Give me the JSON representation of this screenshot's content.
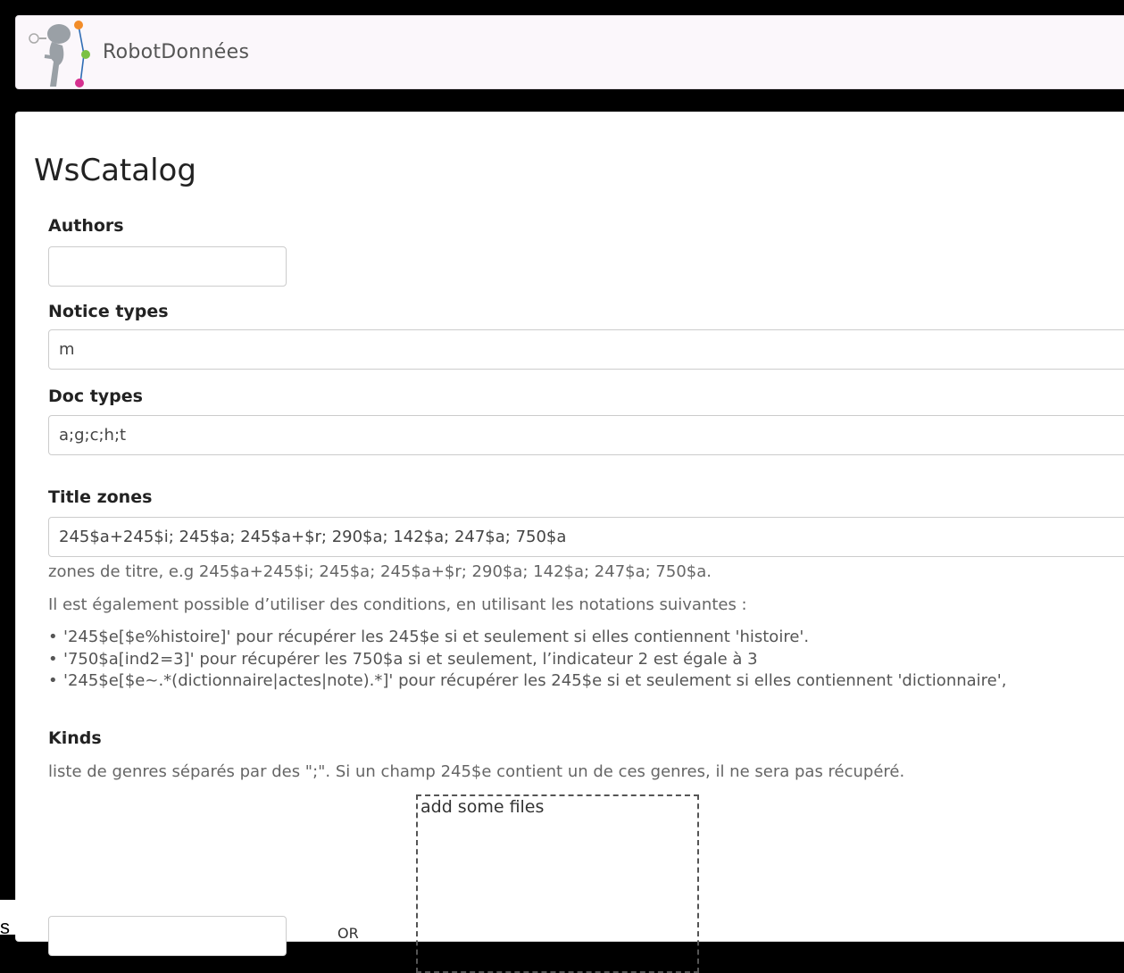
{
  "navbar": {
    "brand": "RobotDonnées"
  },
  "page": {
    "title": "WsCatalog"
  },
  "fields": {
    "authors": {
      "label": "Authors",
      "value": ""
    },
    "notice_types": {
      "label": "Notice types",
      "value": "m"
    },
    "doc_types": {
      "label": "Doc types",
      "value": "a;g;c;h;t"
    },
    "title_zones": {
      "label": "Title zones",
      "value": "245$a+245$i; 245$a; 245$a+$r; 290$a; 142$a; 247$a; 750$a",
      "help": "zones de titre, e.g 245$a+245$i; 245$a; 245$a+$r; 290$a; 142$a; 247$a; 750$a.",
      "conditions_intro": "Il est également possible d’utiliser des conditions, en utilisant les notations suivantes :",
      "conditions": [
        "'245$e[$e%histoire]' pour récupérer les 245$e si et seulement si elles contiennent 'histoire'.",
        "'750$a[ind2=3]' pour récupérer les 750$a si et seulement, l’indicateur 2 est égale à 3",
        "'245$e[$e~.*(dictionnaire|actes|note).*]' pour récupérer les 245$e si et seulement si elles contiennent 'dictionnaire',"
      ]
    },
    "kinds": {
      "label": "Kinds",
      "help": "liste de genres séparés par des \";\". Si un champ 245$e contient un de ces genres, il ne sera pas récupéré.",
      "dropzone_label": "add some files",
      "or_label": "OR"
    }
  },
  "corner_fragment": "s",
  "colors": {
    "logo_orange": "#f28c28",
    "logo_green": "#7ac143",
    "logo_pink": "#d6308f",
    "logo_blue": "#2f6db5"
  }
}
